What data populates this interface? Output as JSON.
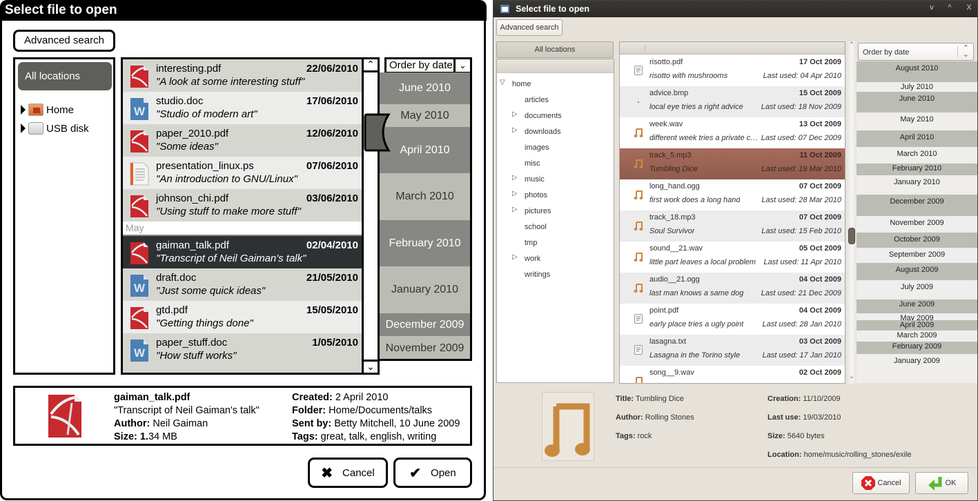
{
  "mockup": {
    "title": "Select file to open",
    "advanced_search_label": "Advanced search",
    "locations": {
      "all_label": "All locations",
      "items": [
        {
          "label": "Home",
          "icon": "home-folder-icon"
        },
        {
          "label": "USB disk",
          "icon": "usb-disk-icon"
        }
      ]
    },
    "files": [
      {
        "name": "interesting.pdf",
        "desc": "\"A look at some interesting stuff\"",
        "date": "22/06/2010",
        "type": "pdf"
      },
      {
        "name": "studio.doc",
        "desc": "\"Studio of modern art\"",
        "date": "17/06/2010",
        "type": "doc"
      },
      {
        "name": "paper_2010.pdf",
        "desc": "\"Some ideas\"",
        "date": "12/06/2010",
        "type": "pdf"
      },
      {
        "name": "presentation_linux.ps",
        "desc": "\"An introduction to GNU/Linux\"",
        "date": "07/06/2010",
        "type": "ps"
      },
      {
        "name": "johnson_chi.pdf",
        "desc": "\"Using stuff to make more stuff\"",
        "date": "03/06/2010",
        "type": "pdf"
      },
      {
        "name": "gaiman_talk.pdf",
        "desc": "\"Transcript of Neil Gaiman's talk\"",
        "date": "02/04/2010",
        "type": "pdf",
        "selected": true
      },
      {
        "name": "draft.doc",
        "desc": "\"Just some quick ideas\"",
        "date": "21/05/2010",
        "type": "doc"
      },
      {
        "name": "gtd.pdf",
        "desc": "\"Getting things done\"",
        "date": "15/05/2010",
        "type": "pdf"
      },
      {
        "name": "paper_stuff.doc",
        "desc": "\"How stuff works\"",
        "date": "1/05/2010",
        "type": "doc"
      }
    ],
    "group_separator": "May",
    "order_by_label": "Order by date",
    "timeline": [
      "June 2010",
      "May 2010",
      "April 2010",
      "March 2010",
      "February 2010",
      "January 2010",
      "December 2009",
      "November 2009"
    ],
    "details": {
      "name": "gaiman_talk.pdf",
      "desc": "\"Transcript of Neil Gaiman's talk\"",
      "author_label": "Author:",
      "author": "Neil Gaiman",
      "size_label": "Size: 1.",
      "size": "34 MB",
      "created_label": "Created:",
      "created": "2 April 2010",
      "folder_label": "Folder:",
      "folder": "Home/Documents/talks",
      "sent_label": "Sent by:",
      "sent": "Betty Mitchell, 10 June 2009",
      "tags_label": "Tags:",
      "tags": "great, talk, english, writing"
    },
    "cancel_label": "Cancel",
    "open_label": "Open"
  },
  "gtk": {
    "title": "Select file to open",
    "window_buttons": [
      "v",
      "^",
      "X"
    ],
    "advanced_search_label": "Advanced search",
    "all_locations_label": "All locations",
    "tree": [
      {
        "label": "home",
        "level": 0,
        "expander": "expanded"
      },
      {
        "label": "articles",
        "level": 1,
        "expander": "none"
      },
      {
        "label": "documents",
        "level": 1,
        "expander": "collapsed"
      },
      {
        "label": "downloads",
        "level": 1,
        "expander": "collapsed"
      },
      {
        "label": "images",
        "level": 1,
        "expander": "none"
      },
      {
        "label": "misc",
        "level": 1,
        "expander": "none"
      },
      {
        "label": "music",
        "level": 1,
        "expander": "collapsed"
      },
      {
        "label": "photos",
        "level": 1,
        "expander": "collapsed"
      },
      {
        "label": "pictures",
        "level": 1,
        "expander": "collapsed"
      },
      {
        "label": "school",
        "level": 1,
        "expander": "none"
      },
      {
        "label": "tmp",
        "level": 1,
        "expander": "none"
      },
      {
        "label": "work",
        "level": 1,
        "expander": "collapsed"
      },
      {
        "label": "writings",
        "level": 1,
        "expander": "none"
      }
    ],
    "files": [
      {
        "name": "risotto.pdf",
        "desc": "risotto with mushrooms",
        "date": "17 Oct 2009",
        "used": "Last used: 04 Apr 2010",
        "type": "doc"
      },
      {
        "name": "advice.bmp",
        "desc": "local eye tries a right advice",
        "date": "15 Oct 2009",
        "used": "Last used: 18 Nov 2009",
        "type": "img"
      },
      {
        "name": "week.wav",
        "desc": "different week tries a private c…",
        "date": "13 Oct 2009",
        "used": "Last used: 07 Dec 2009",
        "type": "audio"
      },
      {
        "name": "track_5.mp3",
        "desc": "Tumbling Dice",
        "date": "11 Oct 2009",
        "used": "Last used: 19 Mar 2010",
        "type": "audio",
        "selected": true
      },
      {
        "name": "long_hand.ogg",
        "desc": "first work does a long hand",
        "date": "07 Oct 2009",
        "used": "Last used: 28 Mar 2010",
        "type": "audio"
      },
      {
        "name": "track_18.mp3",
        "desc": "Soul Survivor",
        "date": "07 Oct 2009",
        "used": "Last used: 15 Feb 2010",
        "type": "audio"
      },
      {
        "name": "sound__21.wav",
        "desc": "little part leaves a local problem",
        "date": "05 Oct 2009",
        "used": "Last used: 11 Apr 2010",
        "type": "audio"
      },
      {
        "name": "audio__21.ogg",
        "desc": "last man knows a same dog",
        "date": "04 Oct 2009",
        "used": "Last used: 21 Dec 2009",
        "type": "audio"
      },
      {
        "name": "point.pdf",
        "desc": "early place tries a ugly point",
        "date": "04 Oct 2009",
        "used": "Last used: 28 Jan 2010",
        "type": "doc"
      },
      {
        "name": "lasagna.txt",
        "desc": "Lasagna in the Torino style",
        "date": "03 Oct 2009",
        "used": "Last used: 17 Jan 2010",
        "type": "doc"
      },
      {
        "name": "song__9.wav",
        "desc": "",
        "date": "02 Oct 2009",
        "used": "",
        "type": "audio"
      }
    ],
    "order_by_label": "Order by date",
    "timeline": [
      "August 2010",
      "July 2010",
      "June 2010",
      "May 2010",
      "April 2010",
      "March 2010",
      "February 2010",
      "January 2010",
      "December 2009",
      "November 2009",
      "October 2009",
      "September 2009",
      "August 2009",
      "July 2009",
      "June 2009",
      "May 2009",
      "April 2009",
      "March 2009",
      "February 2009",
      "January 2009"
    ],
    "details": {
      "title_label": "Title:",
      "title": "Tumbling Dice",
      "author_label": "Author:",
      "author": "Rolling Stones",
      "tags_label": "Tags:",
      "tags": "rock",
      "creation_label": "Creation:",
      "creation": "11/10/2009",
      "lastuse_label": "Last use:",
      "lastuse": "19/03/2010",
      "size_label": "Size:",
      "size": "5640 bytes",
      "location_label": "Location:",
      "location": "home/music/rolling_stones/exile"
    },
    "cancel_label": "Cancel",
    "ok_label": "OK"
  }
}
